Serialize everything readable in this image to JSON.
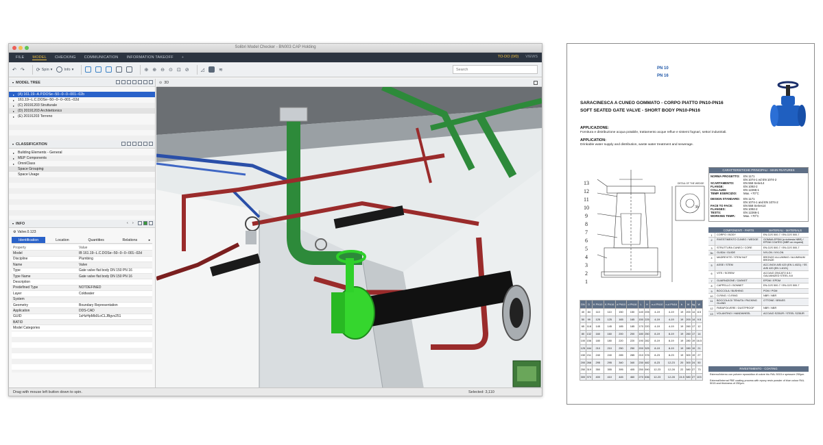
{
  "window": {
    "title": "Solibri Model Checker - BN003 CAP Holding"
  },
  "menu": {
    "items": [
      "FILE",
      "MODEL",
      "CHECKING",
      "COMMUNICATION",
      "INFORMATION TAKEOFF",
      "+"
    ],
    "todo": "TO-DO (0/0)",
    "views": "VIEWS"
  },
  "toolbar": {
    "spin_label": "Spin",
    "info_label": "Info",
    "search_placeholder": "Search"
  },
  "model_tree": {
    "title": "MODEL TREE",
    "rows": [
      "(A) 161.19--A.P.DOSe--50--0--0--001--02b",
      "161.19--L.C.DOSe--50--0--0--001--02d",
      "(C) 20191203 Strutturale",
      "(D) 20191203 Architettonico",
      "(E) 20191203 Terreno"
    ]
  },
  "classification": {
    "title": "CLASSIFICATION",
    "rows": [
      "Building Elements - General",
      "MEP Components",
      "OmniClass",
      "Space Grouping",
      "Space Usage"
    ]
  },
  "info": {
    "title": "INFO",
    "object": "Valve.0.123",
    "tabs": [
      "Identification",
      "Location",
      "Quantities",
      "Relations"
    ],
    "header": {
      "k": "Property",
      "v": "Value"
    },
    "properties": [
      {
        "k": "Model",
        "v": "IB 161.19--L.C.DOSe--50--0--0--001--02d"
      },
      {
        "k": "Discipline",
        "v": "Plumbing"
      },
      {
        "k": "Name",
        "v": "Valve"
      },
      {
        "k": "Type",
        "v": "Gate valve flat body DN 150 PN 16"
      },
      {
        "k": "Type Name",
        "v": "Gate valve flat body DN 150 PN 16"
      },
      {
        "k": "Description",
        "v": ""
      },
      {
        "k": "Predefined Type",
        "v": "NOTDEFINED"
      },
      {
        "k": "Layer",
        "v": "Coldwater"
      },
      {
        "k": "System",
        "v": ""
      },
      {
        "k": "Geometry",
        "v": "Boundary Representation"
      },
      {
        "k": "Application",
        "v": "DDS-CAD"
      },
      {
        "k": "GUID",
        "v": "1sHzHpMb0LoCLJBgvv251"
      },
      {
        "k": "BATID",
        "v": ""
      },
      {
        "k": "Model Categories",
        "v": ""
      }
    ]
  },
  "view3d": {
    "title": "3D"
  },
  "status": {
    "left": "Drag with mouse left button down to spin.",
    "right": "Selected: 3,110"
  },
  "datasheet": {
    "pn1": "PN 10",
    "pn2": "PN 16",
    "title_it": "SARACINESCA A CUNEO GOMMATO - CORPO PIATTO PN10-PN16",
    "title_en": "SOFT SEATED GATE VALVE - SHORT BODY PN10-PN16",
    "app_it_h": "APPLICAZIONE:",
    "app_it": "Fornitura e distribuzione acqua potabile, trattamento acque reflue e sistemi fognari, settori industriali.",
    "app_en_h": "APPLICATION:",
    "app_en": "Drinkable water supply and distribution, waste water treatment and sewerage.",
    "detail_label": "DETAIL OF THE WEDGE",
    "features_title": "CARATTERISTICHE PRINCIPALI - MAIN FEATURES",
    "features": [
      {
        "k": "NORMA PROGETTO:",
        "v": "EN 1171"
      },
      {
        "k": "",
        "v": "EN 1074-1 ed EN 1074-2"
      },
      {
        "k": "SCARTAMENTO:",
        "v": "EN 558 Serie14"
      },
      {
        "k": "FLANGE:",
        "v": "EN 1092-2"
      },
      {
        "k": "COLLAUDI:",
        "v": "EN 12266-1"
      },
      {
        "k": "TEMP. ESERCIZIO:",
        "v": "Max. +70°C"
      },
      {
        "k": "DESIGN STANDARD:",
        "v": "EN 1171"
      },
      {
        "k": "",
        "v": "EN 1074-1 and EN 1074-2"
      },
      {
        "k": "FACE TO FACE:",
        "v": "EN 558 Series14"
      },
      {
        "k": "FLANGES:",
        "v": "EN 1092-2"
      },
      {
        "k": "TESTS:",
        "v": "EN 12266-1"
      },
      {
        "k": "WORKING TEMP.:",
        "v": "Max. +70°C"
      }
    ],
    "parts_head": {
      "c": "COMPONENTI - PARTS",
      "m": "MATERIALI - MATERIALS"
    },
    "parts": [
      {
        "n": "1",
        "c": "CORPO / BODY",
        "m": "EN-GJS 500-7 / EN-GJS 500-7"
      },
      {
        "n": "2",
        "c": "RIVESTIMENTO CUNEO / WEDGE",
        "m": "GOMMA EPDM (a richiesta NBR) / EPDM COATED (NBR on request)"
      },
      {
        "n": "3",
        "c": "STRUTTURA CUNEO / CORE",
        "m": "EN-GJS 500-7 / EN-GJS 500-7"
      },
      {
        "n": "3b",
        "c": "GUIDA / GUIDE",
        "m": "NYLON / NYLON"
      },
      {
        "n": "4",
        "c": "MADREVITE / STEM NUT",
        "m": "BRONZO ALLUMINIO / ALUMINUM BRONZE"
      },
      {
        "n": "5",
        "c": "ASSE / STEM",
        "m": "ACC.INOX AISI 420 (EN 1.4021) / SS AISI 420 (EN 1.4021)"
      },
      {
        "n": "6",
        "c": "VITE / SCREW",
        "m": "ACCIAIO ZINCATO 8.8 / GALVANIZED STEEL 8.8"
      },
      {
        "n": "7",
        "c": "GUARNIZIONE / GASKET",
        "m": "EPDM / EPDM"
      },
      {
        "n": "8",
        "c": "CAPPELLO / BONNET",
        "m": "EN-GJS 500-7 / EN-GJS 500-7"
      },
      {
        "n": "9",
        "c": "BOCCOLA / BUSHING",
        "m": "POM / POM"
      },
      {
        "n": "10",
        "c": "O-RING / O-RING",
        "m": "NBR / NBR"
      },
      {
        "n": "11",
        "c": "BOCCOLA DI TENUTA / PACKING GLAND",
        "m": "OTTONE / BRASS"
      },
      {
        "n": "12",
        "c": "PARAPOLVERE / DUSTPROOF",
        "m": "NBR / NBR"
      },
      {
        "n": "13",
        "c": "VOLANTINO / HANDWHEEL",
        "m": "ACCIAIO S235JR / STEEL S235JR"
      }
    ],
    "dims_head": [
      "DN",
      "D",
      "K PN10",
      "K PN16",
      "d PN10",
      "d PN16",
      "L",
      "H",
      "n-d PN10",
      "n-d PN16",
      "b",
      "W",
      "kg",
      "W"
    ],
    "dims": [
      [
        "40",
        "84",
        "110",
        "110",
        "150",
        "150",
        "140",
        "205",
        "4-19",
        "4-19",
        "19",
        "200",
        "14",
        "8.5"
      ],
      [
        "50",
        "99",
        "125",
        "125",
        "165",
        "165",
        "150",
        "225",
        "4-19",
        "4-19",
        "19",
        "200",
        "14",
        "9.5"
      ],
      [
        "65",
        "118",
        "145",
        "145",
        "185",
        "185",
        "170",
        "220",
        "4-19",
        "4-19",
        "19",
        "260",
        "17",
        "12"
      ],
      [
        "80",
        "132",
        "160",
        "160",
        "200",
        "200",
        "180",
        "250",
        "8-19",
        "8-19",
        "19",
        "260",
        "17",
        "14"
      ],
      [
        "100",
        "156",
        "180",
        "180",
        "220",
        "220",
        "190",
        "282",
        "8-19",
        "8-19",
        "19",
        "280",
        "19",
        "16.5"
      ],
      [
        "125",
        "184",
        "210",
        "210",
        "250",
        "250",
        "200",
        "325",
        "8-19",
        "8-19",
        "19",
        "280",
        "19",
        "21"
      ],
      [
        "150",
        "211",
        "240",
        "240",
        "285",
        "285",
        "210",
        "376",
        "8-23",
        "8-23",
        "19",
        "300",
        "19",
        "27"
      ],
      [
        "200",
        "266",
        "295",
        "295",
        "340",
        "340",
        "230",
        "482",
        "8-23",
        "12-23",
        "20",
        "300",
        "24",
        "50"
      ],
      [
        "250",
        "319",
        "350",
        "355",
        "395",
        "405",
        "250",
        "590",
        "12-23",
        "12-28",
        "22",
        "580",
        "27",
        "73"
      ],
      [
        "300",
        "370",
        "400",
        "410",
        "445",
        "460",
        "270",
        "636",
        "12-23",
        "12-28",
        "24.5",
        "580",
        "27",
        "103"
      ]
    ],
    "coat_title": "RIVESTIMENTO - COATING",
    "coat_it": "Esterno/Interno con polvere epossidica di colore blu RAL 5015 e spessore 250µm.",
    "coat_en": "External/Internal FBE coating process with epoxy resin powder of blue colour RAL 5015 and thickness of 250µm.",
    "drawing_numbers": [
      "13",
      "12",
      "11",
      "10",
      "9",
      "8",
      "7",
      "6",
      "5",
      "4",
      "3",
      "2",
      "1"
    ]
  },
  "colors": {
    "menubar": "#2c3440",
    "accent": "#f0c040",
    "selection": "#2a62c9",
    "pipe_green": "#2d8a3a",
    "pipe_red": "#9a2b2b",
    "pipe_blue": "#2a4fa8",
    "valve_green": "#35d62e",
    "valve_blue": "#1f5fc0"
  }
}
